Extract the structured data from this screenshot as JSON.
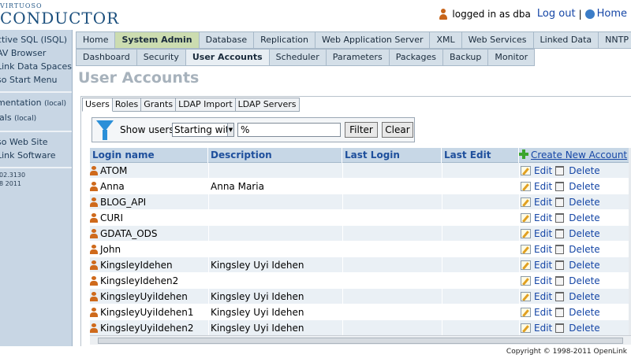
{
  "header": {
    "logo_small": "VIRTUOSO",
    "logo_big": "CONDUCTOR",
    "logged_in_text": "logged in as dba",
    "logout_label": "Log out",
    "separator": "|",
    "home_label": "Home"
  },
  "sidebar": {
    "group1": [
      "ctive SQL (ISQL)",
      "AV Browser",
      "Link Data Spaces",
      "so Start Menu"
    ],
    "group2_a_main": "mentation ",
    "group2_a_small": "(local)",
    "group2_b_main": "ials ",
    "group2_b_small": "(local)",
    "group3": [
      "so Web Site",
      "Link Software"
    ],
    "info_line1": "02.3130",
    "info_line2": "8 2011"
  },
  "tabs_primary": [
    "Home",
    "System Admin",
    "Database",
    "Replication",
    "Web Application Server",
    "XML",
    "Web Services",
    "Linked Data",
    "NNTP"
  ],
  "tabs_secondary": [
    "Dashboard",
    "Security",
    "User Accounts",
    "Scheduler",
    "Parameters",
    "Packages",
    "Backup",
    "Monitor"
  ],
  "page_title": "User Accounts",
  "subtabs": [
    "Users",
    "Roles",
    "Grants",
    "LDAP Import",
    "LDAP Servers"
  ],
  "filter": {
    "label": "Show users",
    "select_value": "Starting with",
    "input_value": "%",
    "filter_button": "Filter",
    "clear_button": "Clear"
  },
  "table": {
    "headers": {
      "login": "Login name",
      "description": "Description",
      "last_login": "Last Login",
      "last_edit": "Last Edit",
      "create": "Create New Account"
    },
    "edit_label": "Edit",
    "delete_label": "Delete",
    "rows": [
      {
        "login": "ATOM",
        "description": ""
      },
      {
        "login": "Anna",
        "description": "Anna Maria"
      },
      {
        "login": "BLOG_API",
        "description": ""
      },
      {
        "login": "CURI",
        "description": ""
      },
      {
        "login": "GDATA_ODS",
        "description": ""
      },
      {
        "login": "John",
        "description": ""
      },
      {
        "login": "KingsleyIdehen",
        "description": "Kingsley Uyi Idehen"
      },
      {
        "login": "KingsleyIdehen2",
        "description": ""
      },
      {
        "login": "KingsleyUyiIdehen",
        "description": "Kingsley Uyi Idehen"
      },
      {
        "login": "KingsleyUyiIdehen1",
        "description": "Kingsley Uyi Idehen"
      },
      {
        "login": "KingsleyUyiIdehen2",
        "description": "Kingsley Uyi Idehen"
      }
    ]
  },
  "footer": {
    "copyright": "Copyright © 1998-2011 OpenLink"
  }
}
